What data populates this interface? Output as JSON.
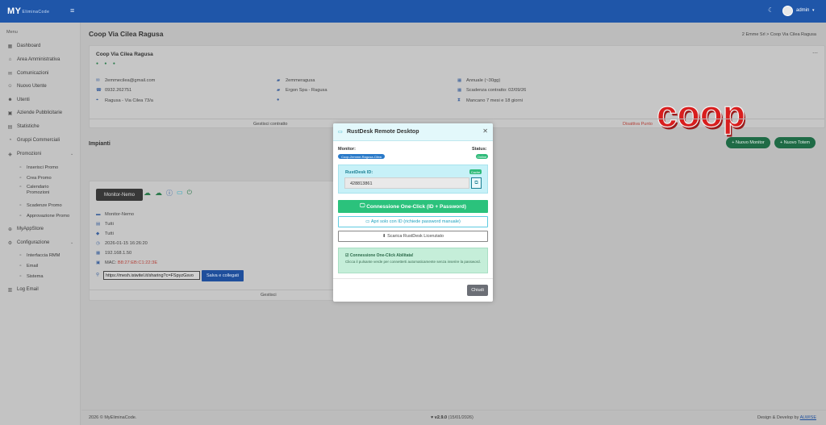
{
  "header": {
    "logo_text": "MY",
    "logo_sub": "EliminaCode",
    "username": "admin"
  },
  "sidebar": {
    "menu_title": "Menu",
    "items": [
      {
        "label": "Dashboard",
        "icon": "dashboard-icon"
      },
      {
        "label": "Area Amministrativa",
        "icon": "building-icon"
      },
      {
        "label": "Comunicazioni",
        "icon": "mail-icon"
      },
      {
        "label": "Nuovo Utente",
        "icon": "user-plus-icon"
      },
      {
        "label": "Utenti",
        "icon": "users-icon"
      },
      {
        "label": "Aziende Pubblicitarie",
        "icon": "briefcase-icon"
      },
      {
        "label": "Statistiche",
        "icon": "chart-icon"
      },
      {
        "label": "Gruppi Commerciali",
        "icon": "group-icon"
      },
      {
        "label": "Promozioni",
        "icon": "promo-icon"
      },
      {
        "label": "Inserisci Promo",
        "icon": "insert-icon"
      },
      {
        "label": "Crea Promo",
        "icon": "edit-icon"
      },
      {
        "label": "Calendario",
        "label2": "Promozioni",
        "icon": "calendar-icon"
      },
      {
        "label": "Scadenze Promo",
        "icon": "clock-icon"
      },
      {
        "label": "Approvazione Promo",
        "icon": "check-icon"
      },
      {
        "label": "MyAppStore",
        "icon": "store-icon"
      },
      {
        "label": "Configurazione",
        "icon": "gear-icon"
      },
      {
        "label": "Interfaccia RMM",
        "icon": "rmm-icon"
      },
      {
        "label": "Email",
        "icon": "mail-icon"
      },
      {
        "label": "Sistema",
        "icon": "system-icon"
      },
      {
        "label": "Log Email",
        "icon": "log-icon"
      }
    ]
  },
  "page": {
    "title": "Coop Via Cilea Ragusa",
    "breadcrumb": "2 Emme Srl  >  Coop Via Cilea Ragusa"
  },
  "store_card": {
    "title": "Coop Via Cilea Ragusa",
    "email": "2emmecilea@gmail.com",
    "phone": "0932.262751",
    "address": "Ragusa - Via Cilea 73/a",
    "company_code": "2emmeragusa",
    "agent": "Ergon Spa - Ragusa",
    "plan": "Annuale (~30gg)",
    "contract_expiry": "Scadenza contratto: 02/09/26",
    "remaining": "Mancano 7 mesi e 18 giorni",
    "manage_contract": "Gestisci contratto",
    "deactivate": "Disattiva Punto",
    "logo_word": "coop"
  },
  "plants": {
    "section_title": "Impianti",
    "btn_new_monitor": "+ Nuovo Monitor",
    "btn_new_totem": "+ Nuovo Totem",
    "monitor_tag": "Monitor-Nemo",
    "name": "Monitor-Nemo",
    "line1": "Tutti",
    "line2": "Tutti",
    "datetime": "2026-01-15 16:26:20",
    "ip": "192.168.1.50",
    "mac_label": "MAC:",
    "mac": "B8:27:EB:C1:22:3E",
    "url": "https://mesh.isiwitel.it/sharing?c=FSpyzGsvo",
    "save_connect": "Salva e collegati",
    "manage": "Gestisci"
  },
  "footer": {
    "copyright": "2026 © MyEliminaCode.",
    "version": "v2.9.0",
    "version_date": "(15/01/2026)",
    "credit": "Design & Develop by",
    "credit_link": "ALWISE"
  },
  "modal": {
    "title": "RustDesk Remote Desktop",
    "monitor_label": "Monitor:",
    "monitor_value": "Coop-2emme-Ragusa-Cilea",
    "status_label": "Status:",
    "status_value": "Online",
    "rustdesk_id_label": "RustDesk ID:",
    "cache_badge": "Cache",
    "rustdesk_id": "428813861",
    "btn_one_click": "Connessione One-Click (ID + Password)",
    "btn_id_only": "Apri solo con ID (richiede password manuale)",
    "btn_download": "Scarica RustDesk Licenziato",
    "info_title": "Connessione One-Click Abilitata!",
    "info_text": "Clicca il pulsante verde per connetterti automaticamente senza inserire la password.",
    "close": "Chiudi"
  },
  "colors": {
    "header_blue": "#1f56a9",
    "modal_cyan": "#c7f1f8",
    "button_green": "#2bc27c",
    "coop_red": "#d81e1e"
  }
}
